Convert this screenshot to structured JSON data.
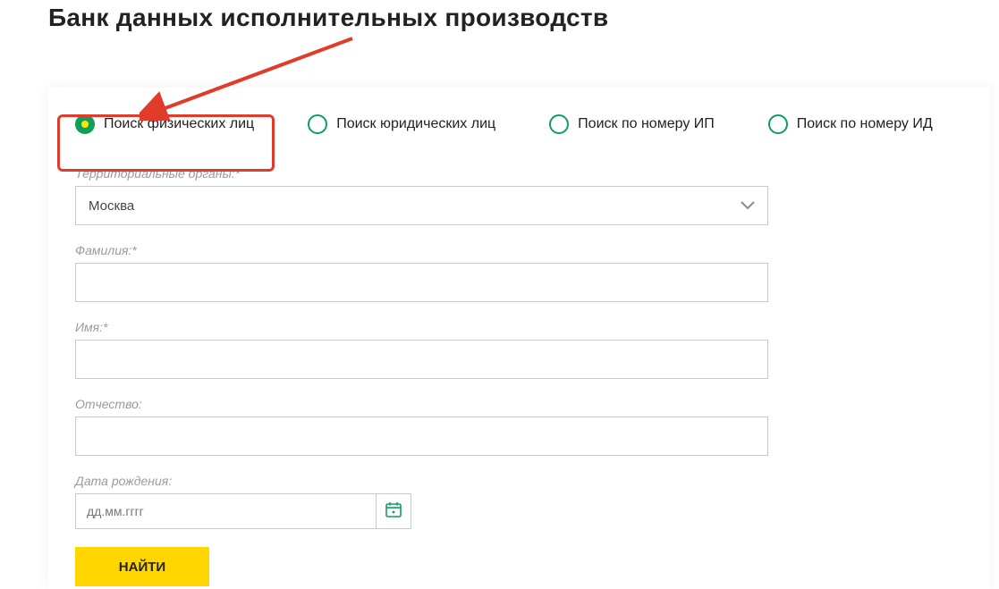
{
  "title": "Банк данных исполнительных производств",
  "tabs": [
    {
      "id": "individuals",
      "label": "Поиск физических лиц",
      "selected": true
    },
    {
      "id": "legal",
      "label": "Поиск юридических лиц",
      "selected": false
    },
    {
      "id": "by-ip",
      "label": "Поиск по номеру ИП",
      "selected": false
    },
    {
      "id": "by-id",
      "label": "Поиск по номеру ИД",
      "selected": false
    }
  ],
  "fields": {
    "territory": {
      "label": "Территориальные органы:*",
      "value": "Москва"
    },
    "lastname": {
      "label": "Фамилия:*",
      "value": ""
    },
    "firstname": {
      "label": "Имя:*",
      "value": ""
    },
    "patronymic": {
      "label": "Отчество:",
      "value": ""
    },
    "birthdate": {
      "label": "Дата рождения:",
      "placeholder": "дд.мм.гггг",
      "value": ""
    }
  },
  "submit_label": "НАЙТИ",
  "annotation": {
    "highlight_target": "individuals",
    "arrow_color": "#e13b2b"
  }
}
